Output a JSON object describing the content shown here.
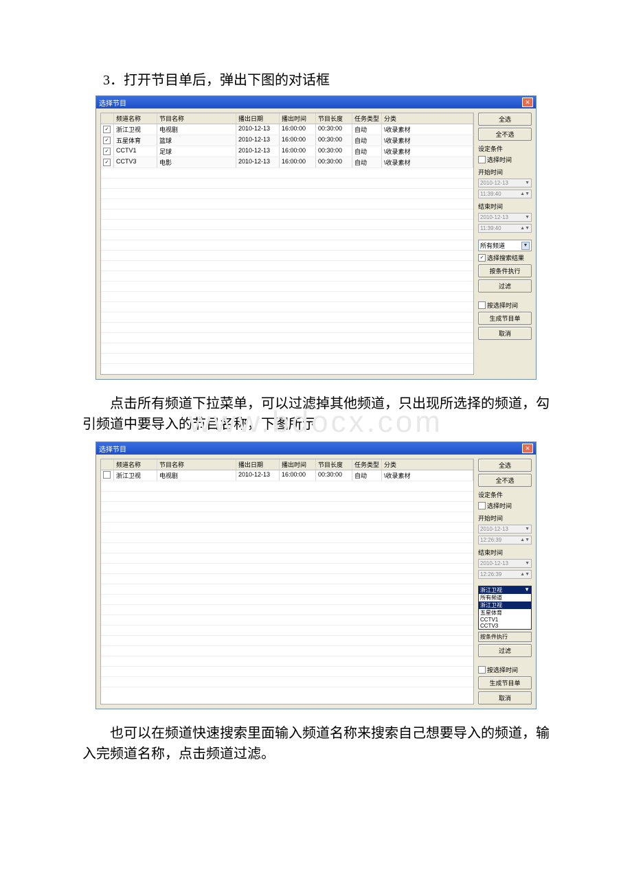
{
  "heading": "3．打开节目单后，弹出下图的对话框",
  "para1": "点击所有频道下拉菜单，可以过滤掉其他频道，只出现所选择的频道，勾引频道中要导入的节目名称，下图所示",
  "para2": "也可以在频道快速搜索里面输入频道名称来搜索自己想要导入的频道，输入完频道名称，点击频道过滤。",
  "watermark": "www.bdocx.com",
  "dialog1": {
    "title": "选择节目",
    "headers": {
      "channel": "频道名称",
      "prog": "节目名称",
      "date": "播出日期",
      "time": "播出时间",
      "len": "节目长度",
      "type": "任务类型",
      "cat": "分类"
    },
    "rows": [
      {
        "checked": true,
        "channel": "浙江卫视",
        "prog": "电视剧",
        "date": "2010-12-13",
        "time": "16:00:00",
        "len": "00:30:00",
        "type": "自动",
        "cat": "\\收录素材"
      },
      {
        "checked": true,
        "channel": "五星体育",
        "prog": "篮球",
        "date": "2010-12-13",
        "time": "16:00:00",
        "len": "00:30:00",
        "type": "自动",
        "cat": "\\收录素材"
      },
      {
        "checked": true,
        "channel": "CCTV1",
        "prog": "足球",
        "date": "2010-12-13",
        "time": "16:00:00",
        "len": "00:30:00",
        "type": "自动",
        "cat": "\\收录素材"
      },
      {
        "checked": true,
        "channel": "CCTV3",
        "prog": "电影",
        "date": "2010-12-13",
        "time": "16:00:00",
        "len": "00:30:00",
        "type": "自动",
        "cat": "\\收录素材"
      }
    ],
    "side": {
      "selectAll": "全选",
      "selectNone": "全不选",
      "condLabel": "设定条件",
      "chkTime": "选择时间",
      "startLabel": "开始时间",
      "startDate": "2010-12-13",
      "startTime": "11:39:40",
      "endLabel": "结束时间",
      "endDate": "2010-12-13",
      "endTime": "11:39:40",
      "channelDrop": "所有频道",
      "chkSearch": "选择搜索结果",
      "btnExec": "按条件执行",
      "btnFilter": "过滤",
      "chkBySel": "按选择时间",
      "btnGen": "生成节目单",
      "btnCancel": "取消"
    }
  },
  "dialog2": {
    "title": "选择节目",
    "rows": [
      {
        "checked": false,
        "channel": "浙江卫视",
        "prog": "电视剧",
        "date": "2010-12-13",
        "time": "16:00:00",
        "len": "00:30:00",
        "type": "自动",
        "cat": "\\收录素材"
      }
    ],
    "side": {
      "selectAll": "全选",
      "selectNone": "全不选",
      "condLabel": "设定条件",
      "chkTime": "选择时间",
      "startLabel": "开始时间",
      "startDate": "2010-12-13",
      "startTime": "12:26:39",
      "endLabel": "结束时间",
      "endDate": "2010-12-13",
      "endTime": "12:26:39",
      "dropSel": "浙江卫视",
      "dropOpts": [
        "所有频道",
        "浙江卫视",
        "五星体育",
        "CCTV1",
        "CCTV3"
      ],
      "execCut": "按条件执行",
      "btnFilter": "过滤",
      "chkBySel": "按选择时间",
      "btnGen": "生成节目单",
      "btnCancel": "取消"
    }
  }
}
